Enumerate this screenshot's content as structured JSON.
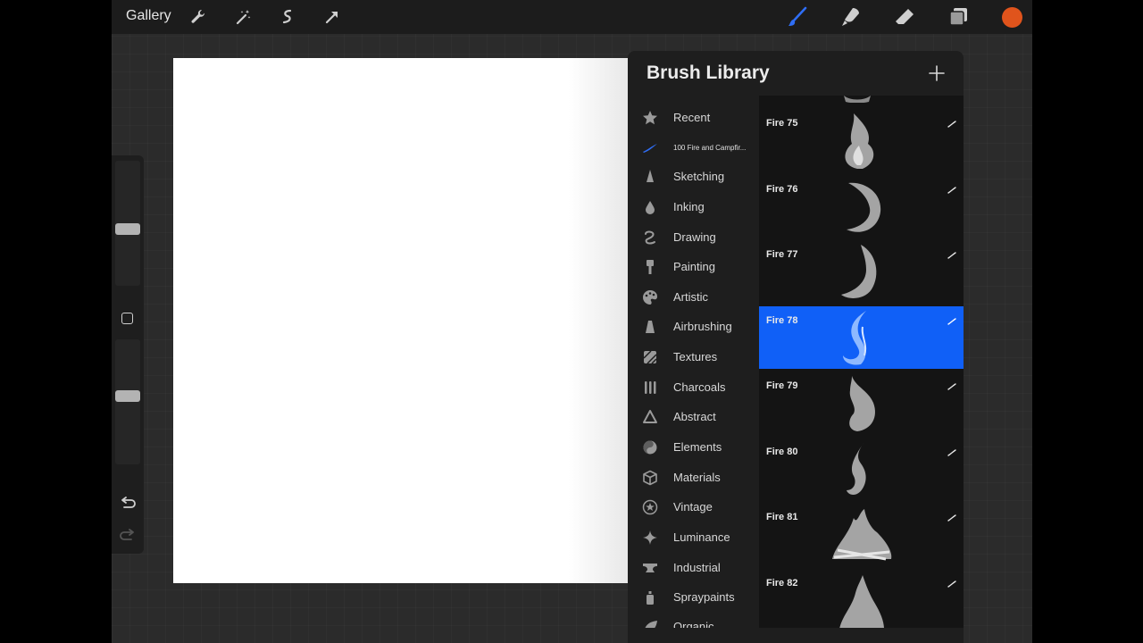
{
  "topbar": {
    "gallery_label": "Gallery",
    "left_tools": [
      "wrench-icon",
      "magic-wand-icon",
      "selection-icon",
      "transform-arrow-icon"
    ],
    "right_tools": [
      "brush-icon",
      "smudge-icon",
      "eraser-icon",
      "layers-icon"
    ],
    "current_color": "#e0541c",
    "brush_tool_color": "#2f6ef5"
  },
  "sidebar": {
    "brush_size_level": 0.45,
    "opacity_level": 0.55
  },
  "brush_library": {
    "title": "Brush Library",
    "add_icon": "plus-icon",
    "selected_category": "100 Fire and Campfir...",
    "categories": [
      {
        "label": "Recent",
        "icon": "star-icon"
      },
      {
        "label": "100 Fire and Campfir...",
        "icon": "brush-stroke-icon"
      },
      {
        "label": "Sketching",
        "icon": "pencil-icon"
      },
      {
        "label": "Inking",
        "icon": "ink-drop-icon"
      },
      {
        "label": "Drawing",
        "icon": "squiggle-icon"
      },
      {
        "label": "Painting",
        "icon": "paintbrush-icon"
      },
      {
        "label": "Artistic",
        "icon": "palette-icon"
      },
      {
        "label": "Airbrushing",
        "icon": "airbrush-icon"
      },
      {
        "label": "Textures",
        "icon": "texture-icon"
      },
      {
        "label": "Charcoals",
        "icon": "charcoal-icon"
      },
      {
        "label": "Abstract",
        "icon": "triangle-icon"
      },
      {
        "label": "Elements",
        "icon": "yin-yang-icon"
      },
      {
        "label": "Materials",
        "icon": "cube-icon"
      },
      {
        "label": "Vintage",
        "icon": "vintage-star-icon"
      },
      {
        "label": "Luminance",
        "icon": "sparkle-icon"
      },
      {
        "label": "Industrial",
        "icon": "anvil-icon"
      },
      {
        "label": "Spraypaints",
        "icon": "spray-can-icon"
      },
      {
        "label": "Organic",
        "icon": "leaf-icon"
      }
    ],
    "brushes": [
      {
        "name": "Fire 75",
        "selected": false
      },
      {
        "name": "Fire 76",
        "selected": false
      },
      {
        "name": "Fire 77",
        "selected": false
      },
      {
        "name": "Fire 78",
        "selected": true
      },
      {
        "name": "Fire 79",
        "selected": false
      },
      {
        "name": "Fire 80",
        "selected": false
      },
      {
        "name": "Fire 81",
        "selected": false
      },
      {
        "name": "Fire 82",
        "selected": false
      }
    ],
    "selected_color": "#1060f7"
  }
}
